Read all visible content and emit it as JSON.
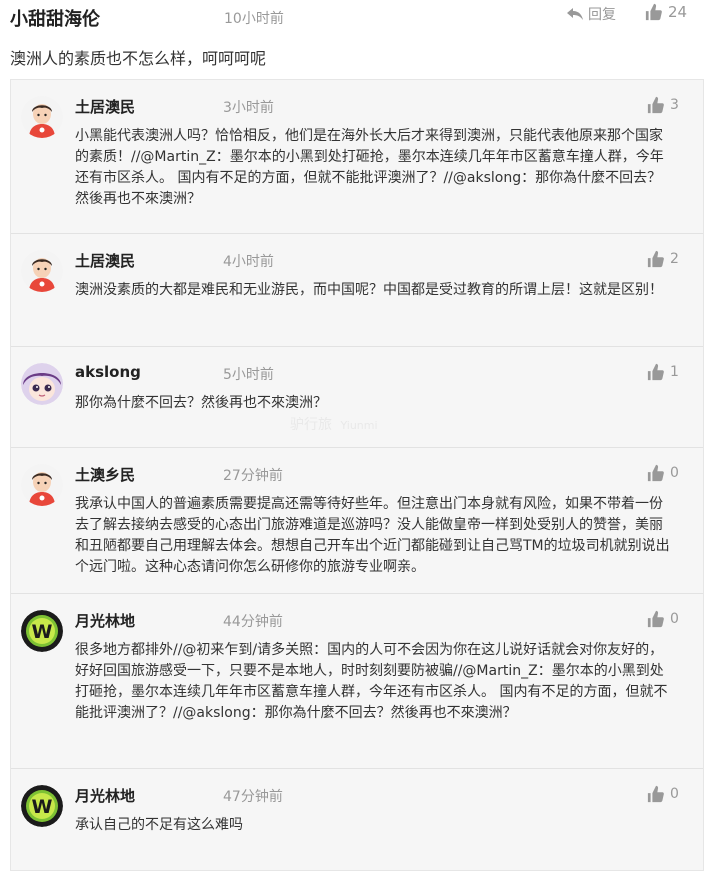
{
  "top": {
    "name": "小甜甜海伦",
    "time": "10小时前",
    "reply_label": "回复",
    "likes": "24",
    "text": "澳洲人的素质也不怎么样，呵呵呵呢"
  },
  "replies": [
    {
      "name": "土居澳民",
      "time": "3小时前",
      "likes": "3",
      "avatar": "boy-avatar",
      "text": "小黑能代表澳洲人吗？恰恰相反，他们是在海外长大后才来得到澳洲，只能代表他原来那个国家的素质！//@Martin_Z：墨尔本的小黑到处打砸抢，墨尔本连续几年年市区蓄意车撞人群，今年还有市区杀人。 国内有不足的方面，但就不能批评澳洲了？//@akslong：那你為什麼不回去？然後再也不來澳洲？"
    },
    {
      "name": "土居澳民",
      "time": "4小时前",
      "likes": "2",
      "avatar": "boy-avatar",
      "text": "澳洲没素质的大都是难民和无业游民，而中国呢？中国都是受过教育的所谓上层！这就是区别！"
    },
    {
      "name": "akslong",
      "time": "5小时前",
      "likes": "1",
      "avatar": "anime-avatar",
      "text": "那你為什麼不回去？然後再也不來澳洲？"
    },
    {
      "name": "土澳乡民",
      "time": "27分钟前",
      "likes": "0",
      "avatar": "boy-avatar",
      "text": "我承认中国人的普遍素质需要提高还需等待好些年。但注意出门本身就有风险，如果不带着一份去了解去接纳去感受的心态出门旅游难道是巡游吗？没人能做皇帝一样到处受别人的赞誉，美丽和丑陋都要自己用理解去体会。想想自己开车出个近门都能碰到让自己骂TM的垃圾司机就别说出个远门啦。这种心态请问你怎么研修你的旅游专业啊亲。"
    },
    {
      "name": "月光林地",
      "time": "44分钟前",
      "likes": "0",
      "avatar": "w-logo-avatar",
      "text": "很多地方都排外//@初来乍到/请多关照：国内的人可不会因为你在这儿说好话就会对你友好的，好好回国旅游感受一下，只要不是本地人，时时刻刻要防被骗//@Martin_Z：墨尔本的小黑到处打砸抢，墨尔本连续几年年市区蓄意车撞人群，今年还有市区杀人。 国内有不足的方面，但就不能批评澳洲了？//@akslong：那你為什麼不回去？然後再也不來澳洲？"
    },
    {
      "name": "月光林地",
      "time": "47分钟前",
      "likes": "0",
      "avatar": "w-logo-avatar",
      "text": "承认自己的不足有这么难吗"
    }
  ],
  "colors": {
    "thumb": "#999999",
    "badge_red": "#e8473a",
    "w_green": "#7ec234"
  },
  "watermark": "驴行旅",
  "watermark_small": "Yiunmi"
}
